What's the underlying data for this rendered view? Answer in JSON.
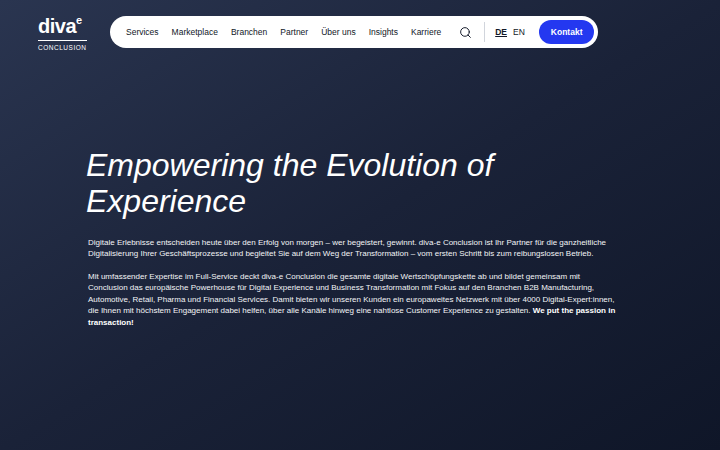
{
  "logo": {
    "name": "diva",
    "sup": "e",
    "sub": "CONCLUSION"
  },
  "nav": {
    "items": [
      "Services",
      "Marketplace",
      "Branchen",
      "Partner",
      "Über uns",
      "Insights",
      "Karriere"
    ],
    "languages": [
      {
        "label": "DE",
        "selected": true
      },
      {
        "label": "EN",
        "selected": false
      }
    ],
    "contact_button": "Kontakt"
  },
  "hero": {
    "title_lines": [
      "Empowering the Evolution of",
      "Experience"
    ],
    "paragraphs": [
      "Digitale Erlebnisse entscheiden heute über den Erfolg von morgen – wer begeistert, gewinnt. diva-e Conclusion ist Ihr Partner für die ganzheitliche Digitalisierung Ihrer Geschäftsprozesse und begleitet Sie auf dem Weg der Transformation – vom ersten Schritt bis zum reibungslosen Betrieb.",
      "Mit umfassender Expertise im Full-Service deckt diva-e Conclusion die gesamte digitale Wertschöpfungskette ab und bildet gemeinsam mit Conclusion das europäische Powerhouse für Digital Experience und Business Transformation mit Fokus auf den Branchen B2B Manufacturing, Automotive, Retail, Pharma und Financial Services. Damit bieten wir unseren Kunden ein europaweites Netzwerk mit über 4000 Digital-Expert:innen, die Ihnen mit höchstem Engagement dabei helfen, über alle Kanäle hinweg eine nahtlose Customer Experience zu gestalten."
    ],
    "tagline": "We put the passion in transaction!"
  }
}
